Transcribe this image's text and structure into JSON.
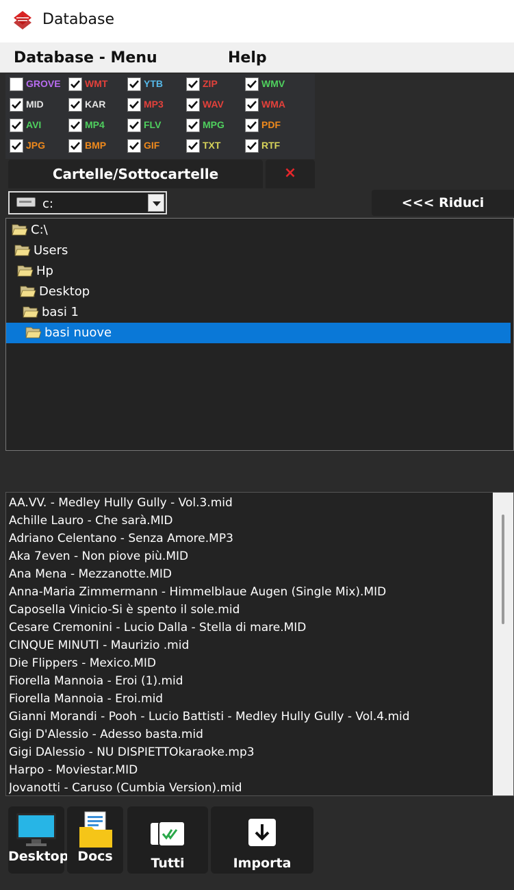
{
  "window": {
    "title": "Database"
  },
  "menu": {
    "items": [
      "Database - Menu",
      "Help"
    ]
  },
  "filters": [
    {
      "label": "GROVE",
      "checked": false,
      "color": "#b86cf0"
    },
    {
      "label": "WMT",
      "checked": true,
      "color": "#e4413b"
    },
    {
      "label": "YTB",
      "checked": true,
      "color": "#56b8e8"
    },
    {
      "label": "ZIP",
      "checked": true,
      "color": "#e4413b"
    },
    {
      "label": "WMV",
      "checked": true,
      "color": "#4fd05e"
    },
    {
      "label": "MID",
      "checked": true,
      "color": "#e6e6e6"
    },
    {
      "label": "KAR",
      "checked": true,
      "color": "#e6e6e6"
    },
    {
      "label": "MP3",
      "checked": true,
      "color": "#e4413b"
    },
    {
      "label": "WAV",
      "checked": true,
      "color": "#e4413b"
    },
    {
      "label": "WMA",
      "checked": true,
      "color": "#e4413b"
    },
    {
      "label": "AVI",
      "checked": true,
      "color": "#4fd05e"
    },
    {
      "label": "MP4",
      "checked": true,
      "color": "#4fd05e"
    },
    {
      "label": "FLV",
      "checked": true,
      "color": "#4fd05e"
    },
    {
      "label": "MPG",
      "checked": true,
      "color": "#4fd05e"
    },
    {
      "label": "PDF",
      "checked": true,
      "color": "#f08a1c"
    },
    {
      "label": "JPG",
      "checked": true,
      "color": "#f08a1c"
    },
    {
      "label": "BMP",
      "checked": true,
      "color": "#f08a1c"
    },
    {
      "label": "GIF",
      "checked": true,
      "color": "#f08a1c"
    },
    {
      "label": "TXT",
      "checked": true,
      "color": "#d7d35a"
    },
    {
      "label": "RTF",
      "checked": true,
      "color": "#d7d35a"
    }
  ],
  "folders_tab": {
    "label": "Cartelle/Sottocartelle",
    "close": "×"
  },
  "drive": {
    "value": "c:"
  },
  "riduci_label": "<<< Riduci",
  "tree": [
    {
      "name": "C:\\",
      "selected": false
    },
    {
      "name": "Users",
      "selected": false
    },
    {
      "name": "Hp",
      "selected": false
    },
    {
      "name": "Desktop",
      "selected": false
    },
    {
      "name": "basi 1",
      "selected": false
    },
    {
      "name": "basi nuove",
      "selected": true
    }
  ],
  "files": [
    "AA.VV. - Medley Hully Gully - Vol.3.mid",
    "Achille Lauro - Che sarà.MID",
    "Adriano Celentano - Senza Amore.MP3",
    "Aka 7even - Non piove più.MID",
    "Ana Mena - Mezzanotte.MID",
    "Anna-Maria Zimmermann - Himmelblaue Augen (Single Mix).MID",
    "Caposella Vinicio-Si è spento il sole.mid",
    "Cesare Cremonini - Lucio Dalla - Stella di mare.MID",
    "CINQUE MINUTI - Maurizio .mid",
    "Die Flippers - Mexico.MID",
    "Fiorella Mannoia - Eroi (1).mid",
    "Fiorella Mannoia - Eroi.mid",
    "Gianni Morandi - Pooh - Lucio Battisti - Medley Hully Gully - Vol.4.mid",
    "Gigi D'Alessio - Adesso basta.mid",
    "Gigi DAlessio - NU DISPIETTOkaraoke.mp3",
    "Harpo - Moviestar.MID",
    "Jovanotti - Caruso (Cumbia Version).mid"
  ],
  "toolbar": {
    "desktop": "Desktop",
    "docs": "Docs",
    "tutti": "Tutti",
    "importa": "Importa"
  }
}
